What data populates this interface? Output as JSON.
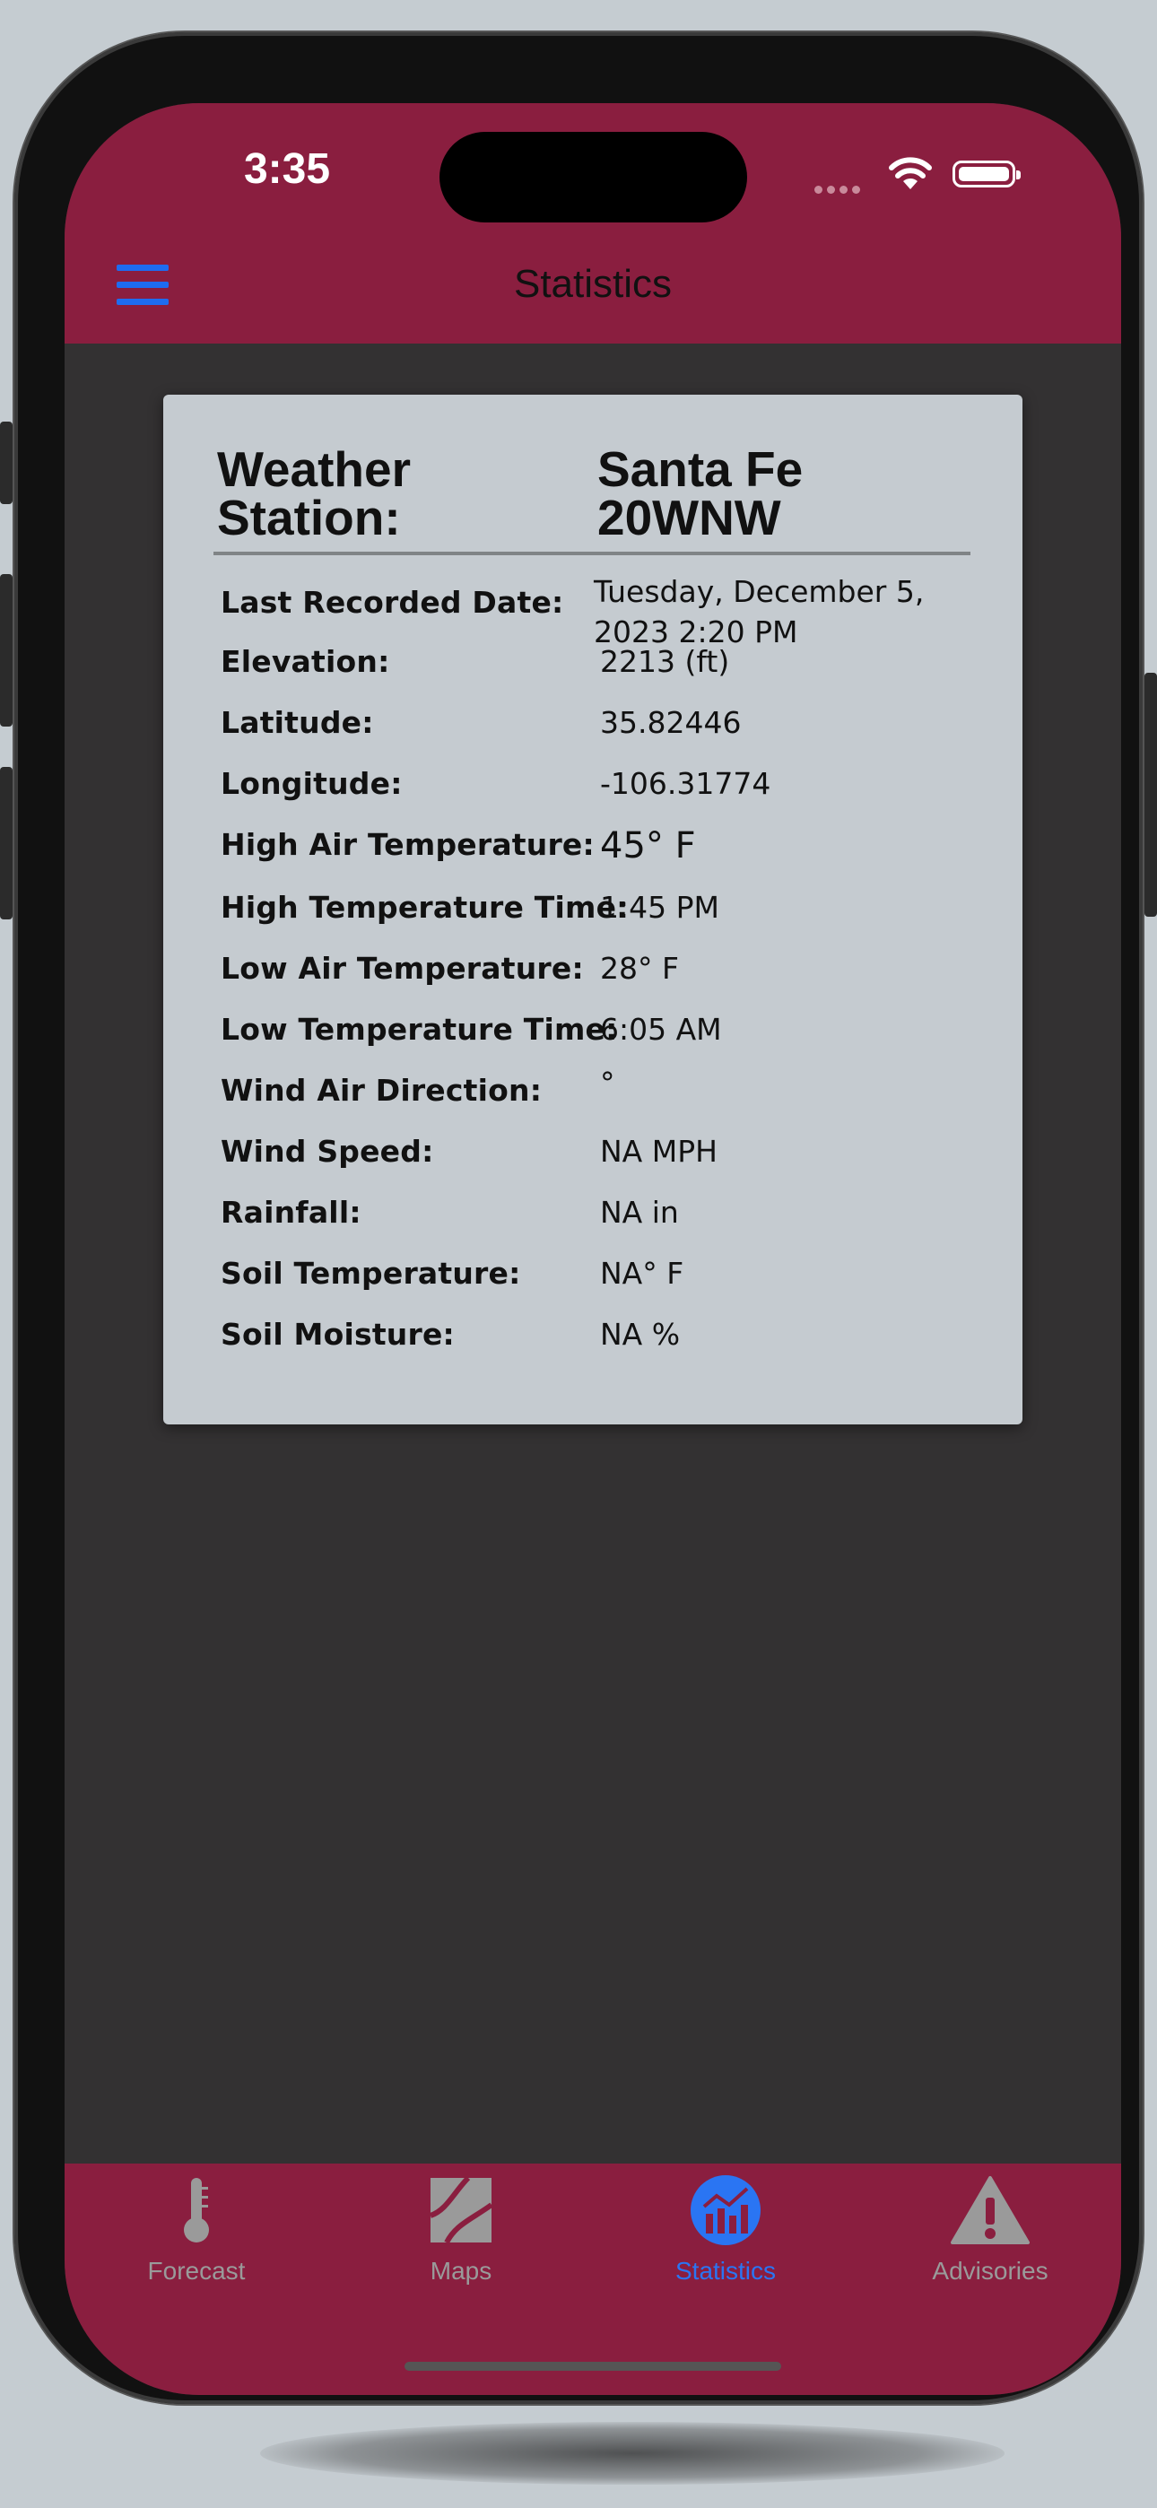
{
  "status_bar": {
    "time": "3:35"
  },
  "header": {
    "title": "Statistics"
  },
  "station": {
    "label": "Weather Station:",
    "label_line1": "Weather",
    "label_line2": "Station:",
    "name_line1": "Santa Fe",
    "name_line2": "20WNW"
  },
  "rows": [
    {
      "label": "Last Recorded Date:",
      "value_line1": "Tuesday, December 5,",
      "value_line2": "2023 2:20 PM"
    },
    {
      "label": "Elevation:",
      "value": "2213 (ft)"
    },
    {
      "label": "Latitude:",
      "value": "35.82446"
    },
    {
      "label": "Longitude:",
      "value": "-106.31774"
    },
    {
      "label": "High Air Temperature:",
      "value": "45° F"
    },
    {
      "label": "High Temperature Time:",
      "value": "1:45 PM"
    },
    {
      "label": "Low Air Temperature:",
      "value": "28° F"
    },
    {
      "label": "Low Temperature Time:",
      "value": "6:05 AM"
    },
    {
      "label": "Wind Air Direction:",
      "value": "°"
    },
    {
      "label": "Wind Speed:",
      "value": "NA MPH"
    },
    {
      "label": "Rainfall:",
      "value": "NA in"
    },
    {
      "label": "Soil Temperature:",
      "value": "NA° F"
    },
    {
      "label": "Soil Moisture:",
      "value": "NA %"
    }
  ],
  "tabs": [
    {
      "label": "Forecast",
      "icon": "thermometer-icon",
      "active": false
    },
    {
      "label": "Maps",
      "icon": "map-icon",
      "active": false
    },
    {
      "label": "Statistics",
      "icon": "chart-icon",
      "active": true
    },
    {
      "label": "Advisories",
      "icon": "warning-icon",
      "active": false
    }
  ],
  "colors": {
    "bar": "#8a1e3f",
    "background": "#333132",
    "card": "#c5cbd0",
    "accent": "#2a75f3",
    "inactive_tab": "#9a9a9a"
  }
}
